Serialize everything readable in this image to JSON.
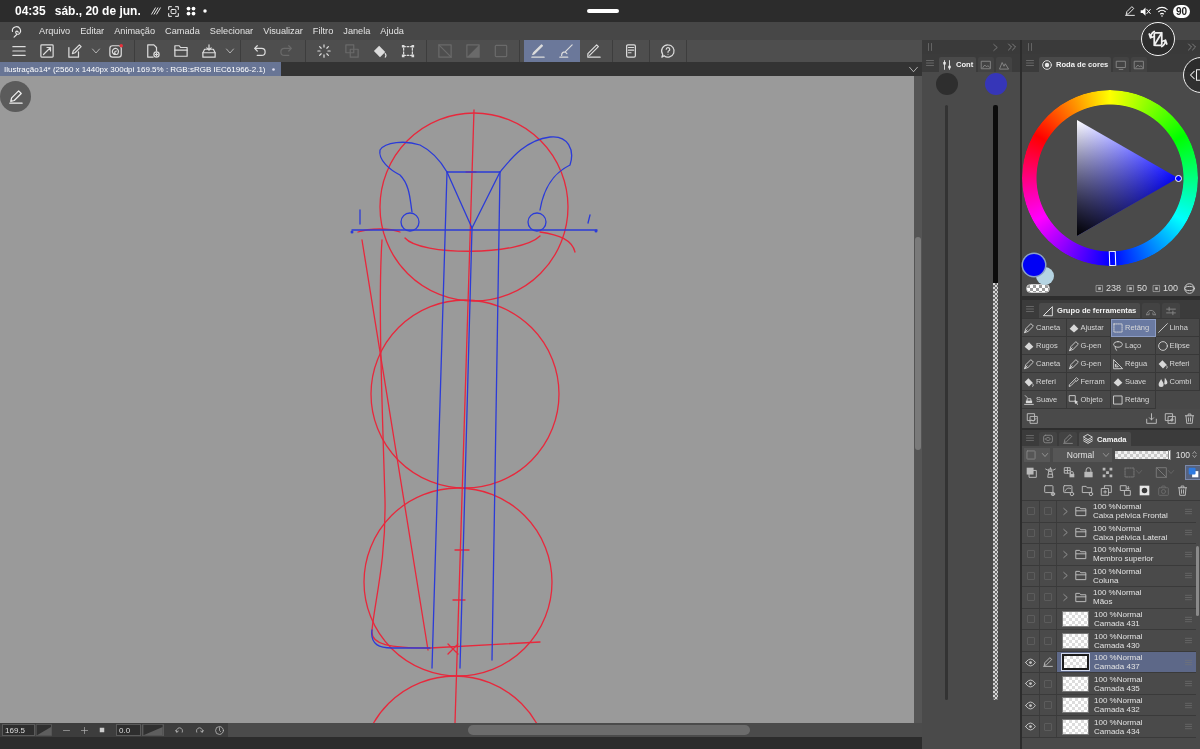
{
  "status_bar": {
    "time": "04:35",
    "date": "sáb., 20 de jun.",
    "battery": "90"
  },
  "menu_bar": {
    "items": [
      "Arquivo",
      "Editar",
      "Animação",
      "Camada",
      "Selecionar",
      "Visualizar",
      "Filtro",
      "Janela",
      "Ajuda"
    ]
  },
  "toolbar": {
    "groups": [
      [
        {
          "kind": "menu",
          "selected": false,
          "disabled": false
        },
        {
          "kind": "resize",
          "selected": false,
          "disabled": false
        },
        {
          "kind": "pen-box",
          "selected": false,
          "disabled": false
        },
        {
          "kind": "caret",
          "selected": false,
          "disabled": false
        },
        {
          "kind": "record",
          "selected": false,
          "disabled": false
        }
      ],
      [
        {
          "kind": "new-file",
          "selected": false,
          "disabled": false
        },
        {
          "kind": "open",
          "selected": false,
          "disabled": false
        },
        {
          "kind": "export",
          "selected": false,
          "disabled": false
        },
        {
          "kind": "caret",
          "selected": false,
          "disabled": false
        }
      ],
      [
        {
          "kind": "undo",
          "selected": false,
          "disabled": false
        },
        {
          "kind": "redo",
          "selected": false,
          "disabled": true
        }
      ],
      [
        {
          "kind": "spinner",
          "selected": false,
          "disabled": false
        },
        {
          "kind": "copy",
          "selected": false,
          "disabled": true
        },
        {
          "kind": "fill",
          "selected": false,
          "disabled": false
        },
        {
          "kind": "transform",
          "selected": false,
          "disabled": false
        }
      ],
      [
        {
          "kind": "slash-square",
          "selected": false,
          "disabled": true
        },
        {
          "kind": "half-square",
          "selected": false,
          "disabled": true
        },
        {
          "kind": "square",
          "selected": false,
          "disabled": true
        }
      ],
      [
        {
          "kind": "stroke",
          "selected": true,
          "disabled": false
        },
        {
          "kind": "brush",
          "selected": true,
          "disabled": false
        },
        {
          "kind": "ruler-pen",
          "selected": false,
          "disabled": false
        }
      ],
      [
        {
          "kind": "tablet",
          "selected": false,
          "disabled": false
        }
      ],
      [
        {
          "kind": "help",
          "selected": false,
          "disabled": false
        }
      ]
    ]
  },
  "document_tab": {
    "title": "Ilustração14* (2560 x 1440px 300dpi 169.5% : RGB:sRGB IEC61966-2.1)",
    "selected": true
  },
  "canvas_footer": {
    "zoom": "169.5",
    "rotation": "0.0"
  },
  "control_panel": {
    "tabs": [
      {
        "kind": "sliders",
        "label": "Cont",
        "selected": true
      },
      {
        "kind": "image",
        "selected": false
      },
      {
        "kind": "mountains",
        "selected": false
      }
    ],
    "previews": [
      {
        "color": "#2e2e2e"
      },
      {
        "color": "#3636b8"
      }
    ]
  },
  "color_panel": {
    "tabs": [
      {
        "kind": "wheel",
        "label": "Roda de cores",
        "selected": true
      },
      {
        "kind": "monitor",
        "selected": false
      },
      {
        "kind": "image",
        "selected": false
      }
    ],
    "hue_marker": {
      "level": 0.661
    },
    "swatches": [
      {
        "kind": "main",
        "color": "#0000f5"
      },
      {
        "kind": "sub",
        "color": "#b5d4e2"
      }
    ],
    "values": [
      "238",
      "50",
      "100"
    ]
  },
  "tool_panel": {
    "tabs": [
      {
        "kind": "tools",
        "label": "Grupo de ferramentas",
        "selected": true
      },
      {
        "kind": "dome",
        "selected": false
      },
      {
        "kind": "settings",
        "selected": false
      }
    ],
    "tools": [
      {
        "kind": "pen",
        "label": "Caneta",
        "selected": false
      },
      {
        "kind": "eraser",
        "label": "Ajustar",
        "selected": false
      },
      {
        "kind": "marquee",
        "label": "Retâng",
        "selected": true
      },
      {
        "kind": "line",
        "label": "Linha",
        "selected": false
      },
      {
        "kind": "eraser",
        "label": "Rugos",
        "selected": false
      },
      {
        "kind": "pen",
        "label": "G-pen",
        "selected": false
      },
      {
        "kind": "lasso",
        "label": "Laço",
        "selected": false
      },
      {
        "kind": "ellipse",
        "label": "Elipse",
        "selected": false
      },
      {
        "kind": "pen",
        "label": "Caneta",
        "selected": false
      },
      {
        "kind": "pen",
        "label": "G-pen",
        "selected": false
      },
      {
        "kind": "ruler",
        "label": "Régua",
        "selected": false
      },
      {
        "kind": "fill",
        "label": "Referi",
        "selected": false
      },
      {
        "kind": "fill",
        "label": "Referi",
        "selected": false
      },
      {
        "kind": "dropper",
        "label": "Ferram",
        "selected": false
      },
      {
        "kind": "eraser",
        "label": "Suave",
        "selected": false
      },
      {
        "kind": "drops",
        "label": "Combi",
        "selected": false
      },
      {
        "kind": "smudge",
        "label": "Suave",
        "selected": false
      },
      {
        "kind": "object",
        "label": "Objeto",
        "selected": false
      },
      {
        "kind": "rect",
        "label": "Retâng",
        "selected": false
      }
    ]
  },
  "layer_panel": {
    "tabs": [
      {
        "kind": "eye-box",
        "selected": false
      },
      {
        "kind": "pencil",
        "selected": false
      },
      {
        "kind": "layers",
        "label": "Camada",
        "selected": true
      }
    ],
    "blend_mode": "Normal",
    "opacity": {
      "value": "100",
      "level": 1
    },
    "layers": [
      {
        "kind": "folder",
        "mode": "100 %Normal",
        "name": "Caixa pélvica Frontal",
        "visible": false,
        "editing": false,
        "selected": false,
        "expanded": false
      },
      {
        "kind": "folder",
        "mode": "100 %Normal",
        "name": "Caixa pélvica Lateral",
        "visible": false,
        "editing": false,
        "selected": false,
        "expanded": false
      },
      {
        "kind": "folder",
        "mode": "100 %Normal",
        "name": "Membro superior",
        "visible": false,
        "editing": false,
        "selected": false,
        "expanded": false
      },
      {
        "kind": "folder",
        "mode": "100 %Normal",
        "name": "Coluna",
        "visible": false,
        "editing": false,
        "selected": false,
        "expanded": false
      },
      {
        "kind": "folder",
        "mode": "100 %Normal",
        "name": "Mãos",
        "visible": false,
        "editing": false,
        "selected": false,
        "expanded": false
      },
      {
        "kind": "layer",
        "mode": "100 %Normal",
        "name": "Camada 431",
        "visible": false,
        "editing": false,
        "selected": false
      },
      {
        "kind": "layer",
        "mode": "100 %Normal",
        "name": "Camada 430",
        "visible": false,
        "editing": false,
        "selected": false
      },
      {
        "kind": "layer",
        "mode": "100 %Normal",
        "name": "Camada 437",
        "visible": true,
        "editing": true,
        "selected": true
      },
      {
        "kind": "layer",
        "mode": "100 %Normal",
        "name": "Camada 435",
        "visible": true,
        "editing": false,
        "selected": false
      },
      {
        "kind": "layer",
        "mode": "100 %Normal",
        "name": "Camada 432",
        "visible": true,
        "editing": false,
        "selected": false
      },
      {
        "kind": "layer",
        "mode": "100 %Normal",
        "name": "Camada 434",
        "visible": true,
        "editing": false,
        "selected": false
      }
    ]
  }
}
